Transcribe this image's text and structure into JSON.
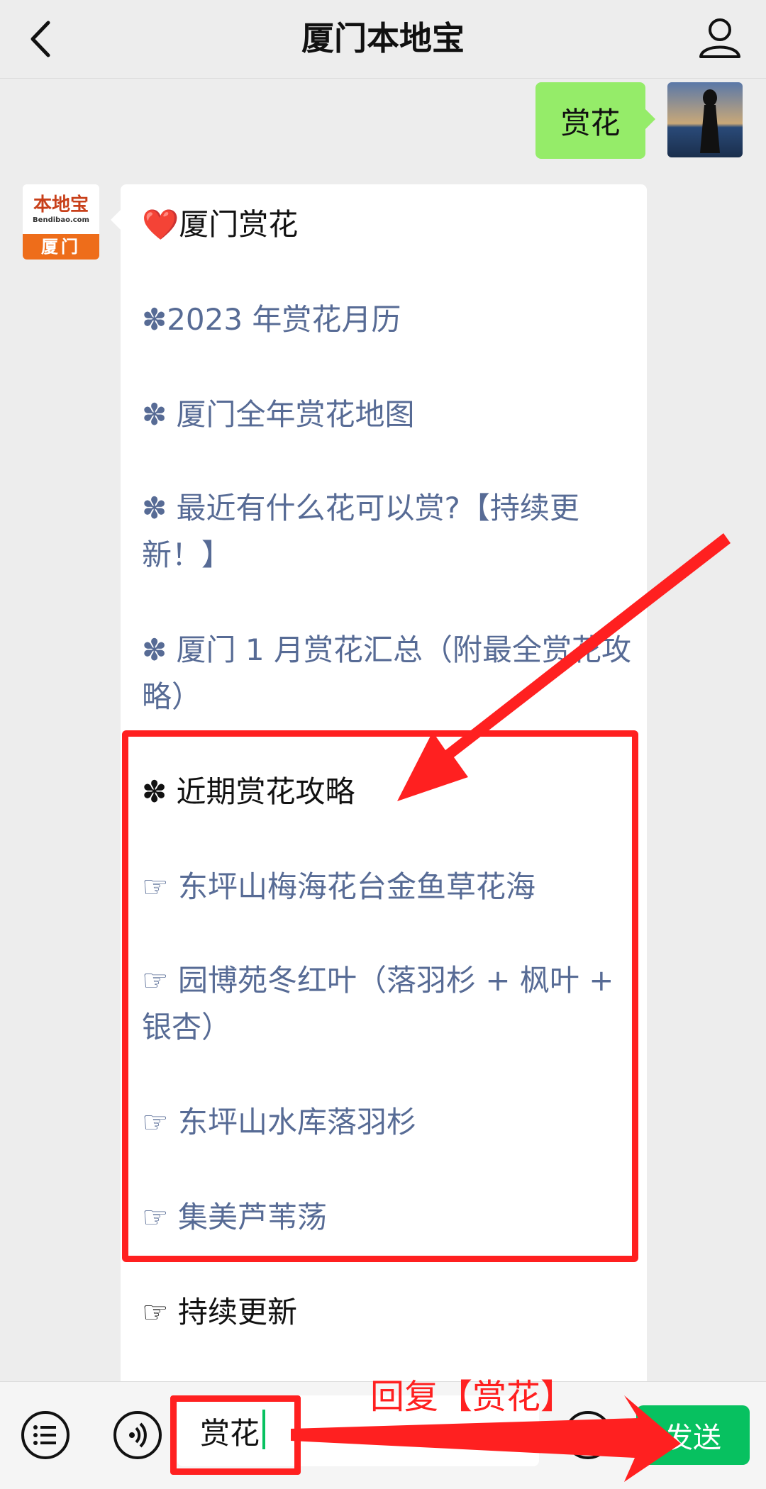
{
  "header": {
    "title": "厦门本地宝",
    "back_icon": "chevron-left-icon",
    "profile_icon": "user-icon"
  },
  "messages": {
    "sent_text": "赏花",
    "reply_lines": [
      "❤️厦门赏花",
      "✽2023 年赏花月历",
      "✽ 厦门全年赏花地图",
      "✽ 最近有什么花可以赏?【持续更新！】",
      "✽ 厦门 1 月赏花汇总（附最全赏花攻略）",
      "✽ 近期赏花攻略",
      "☞ 东坪山梅海花台金鱼草花海",
      "☞ 园博苑冬红叶（落羽杉 + 枫叶 + 银杏）",
      "☞ 东坪山水库落羽杉",
      "☞ 集美芦苇荡",
      "☞ 持续更新"
    ]
  },
  "avatar_brand": {
    "name": "本地宝",
    "url": "Bendibao.com",
    "city": "厦门"
  },
  "input": {
    "value": "赏花",
    "send_label": "发送"
  },
  "annotation": {
    "reply_note": "回复【赏花】"
  },
  "colors": {
    "accent": "#07c160",
    "sent_bubble": "#95ec69",
    "link": "#576b95",
    "annotation": "#ff2020"
  }
}
